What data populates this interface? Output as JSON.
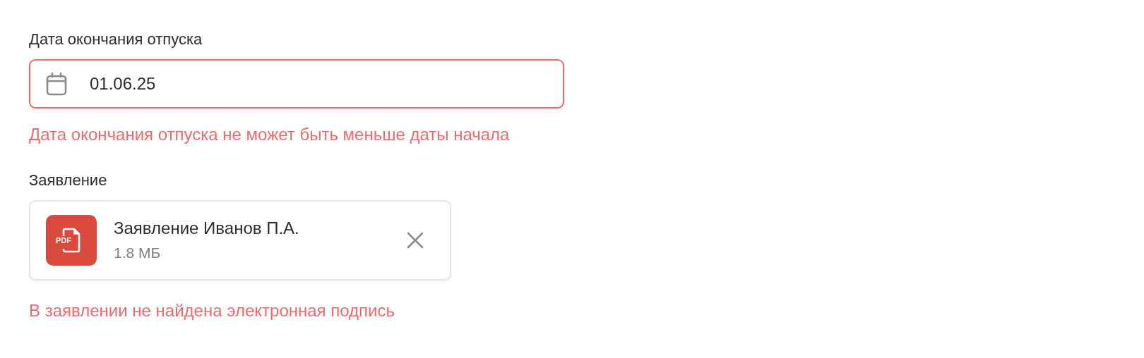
{
  "date_field": {
    "label": "Дата окончания отпуска",
    "value": "01.06.25",
    "invalid": true,
    "error": "Дата окончания отпуска не может быть меньше даты начала"
  },
  "attachment": {
    "label": "Заявление",
    "file": {
      "badge": "PDF",
      "name": "Заявление Иванов П.А.",
      "size": "1.8 МБ"
    },
    "error": "В заявлении не найдена электронная подпись"
  }
}
